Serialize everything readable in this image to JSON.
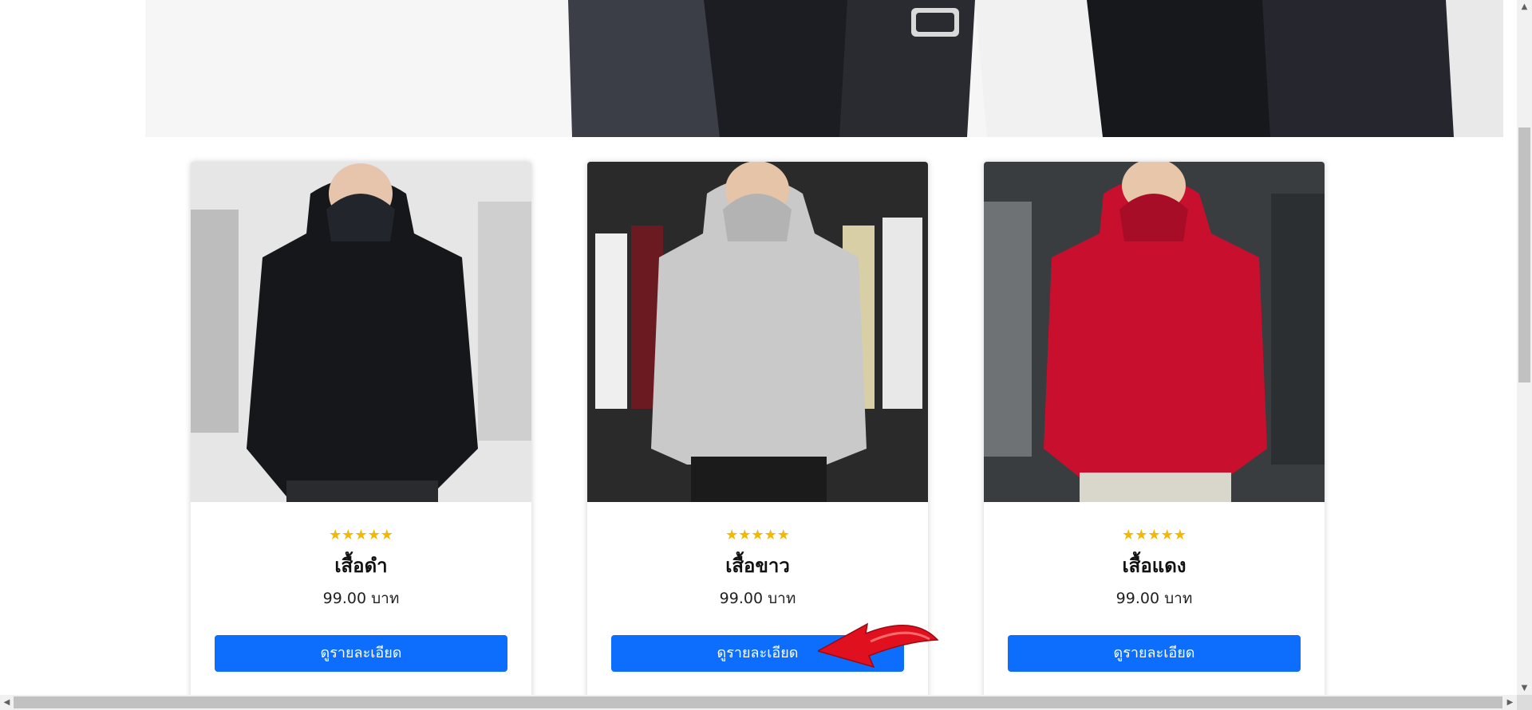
{
  "hero": {
    "image": "hoodies-banner-image"
  },
  "products": [
    {
      "image": "black-hoodie-photo",
      "rating_stars": "★★★★★",
      "rating": 5,
      "name": "เสื้อดำ",
      "price": "99.00 บาท",
      "button_label": "ดูรายละเอียด"
    },
    {
      "image": "gray-hoodie-photo",
      "rating_stars": "★★★★★",
      "rating": 5,
      "name": "เสื้อขาว",
      "price": "99.00 บาท",
      "button_label": "ดูรายละเอียด"
    },
    {
      "image": "red-hoodie-photo",
      "rating_stars": "★★★★★",
      "rating": 5,
      "name": "เสื้อแดง",
      "price": "99.00 บาท",
      "button_label": "ดูรายละเอียด"
    }
  ],
  "colors": {
    "button": "#0d6efd",
    "star": "#f5b800",
    "annotation_arrow": "#e0101e"
  },
  "scrollbars": {
    "up_arrow": "▲",
    "down_arrow": "▼",
    "left_arrow": "◀",
    "right_arrow": "▶"
  }
}
